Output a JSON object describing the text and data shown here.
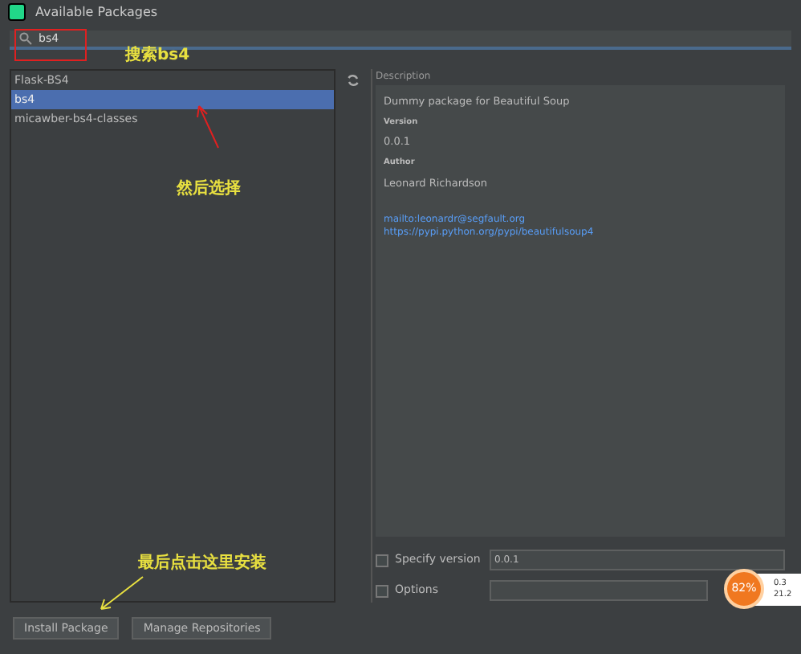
{
  "window": {
    "title": "Available Packages"
  },
  "search": {
    "value": "bs4"
  },
  "packages": [
    {
      "name": "Flask-BS4",
      "selected": false
    },
    {
      "name": "bs4",
      "selected": true
    },
    {
      "name": "micawber-bs4-classes",
      "selected": false
    }
  ],
  "description": {
    "heading": "Description",
    "summary": "Dummy package for Beautiful Soup",
    "version_label": "Version",
    "version": "0.0.1",
    "author_label": "Author",
    "author": "Leonard Richardson",
    "links": [
      "mailto:leonardr@segfault.org",
      "https://pypi.python.org/pypi/beautifulsoup4"
    ]
  },
  "options": [
    {
      "kind": "select",
      "label": "Specify version",
      "checked": false,
      "value": "0.0.1"
    },
    {
      "kind": "text",
      "label": "Options",
      "checked": false
    }
  ],
  "buttons": [
    "Install Package",
    "Manage Repositories"
  ],
  "annotations": [
    "搜索bs4",
    "然后选择",
    "最后点击这里安装"
  ],
  "monitor": {
    "percent": "82%",
    "upload": "0.3",
    "download": "21.2"
  }
}
